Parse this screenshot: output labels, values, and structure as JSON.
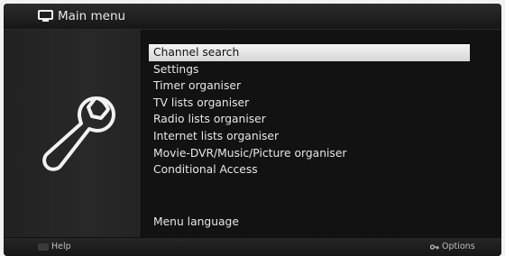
{
  "header": {
    "title": "Main menu",
    "icon": "tv-icon"
  },
  "side_panel": {
    "icon": "wrench-icon"
  },
  "menu": {
    "items": [
      {
        "label": "Channel search",
        "selected": true
      },
      {
        "label": "Settings"
      },
      {
        "label": "Timer organiser"
      },
      {
        "label": "TV lists organiser"
      },
      {
        "label": "Radio lists organiser"
      },
      {
        "label": "Internet lists organiser"
      },
      {
        "label": "Movie-DVR/Music/Picture organiser"
      },
      {
        "label": "Conditional Access"
      }
    ],
    "bottom_item": "Menu language"
  },
  "footer": {
    "help_label": "Help",
    "options_label": "Options",
    "options_icon": "key-icon"
  }
}
